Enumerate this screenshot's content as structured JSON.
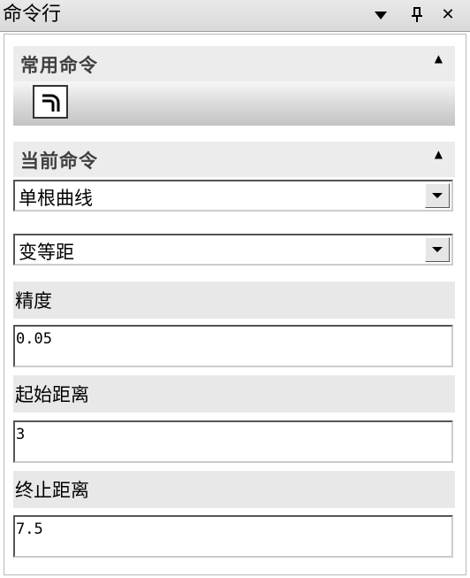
{
  "window": {
    "title": "命令行",
    "icons": [
      "dropdown-arrow-icon",
      "pin-icon",
      "close-icon"
    ],
    "close_glyph": "✕"
  },
  "common": {
    "header": "常用命令",
    "tools": [
      "curve-command-icon"
    ]
  },
  "current": {
    "header": "当前命令",
    "mode_select": "单根曲线",
    "distance_select": "变等距"
  },
  "fields": {
    "precision": {
      "label": "精度",
      "value": "0.05"
    },
    "start_distance": {
      "label": "起始距离",
      "value": "3"
    },
    "end_distance": {
      "label": "终止距离",
      "value": "7.5"
    }
  }
}
